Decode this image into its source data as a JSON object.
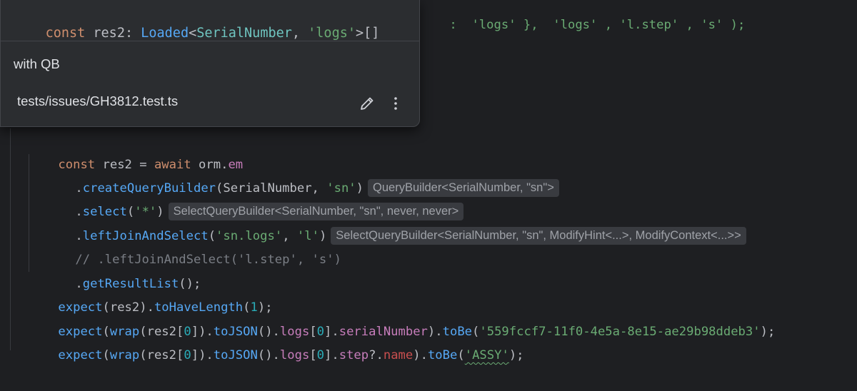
{
  "popup": {
    "signature": {
      "kw": "const",
      "name": "res2",
      "colon": ":",
      "type": "Loaded",
      "lt": "<",
      "cls": "SerialNumber",
      "comma": ", ",
      "str": "'logs'",
      "gt": ">[]"
    },
    "doc": "with QB",
    "file": "tests/issues/GH3812.test.ts",
    "edit_icon": "pencil-icon",
    "more_icon": "more-vertical-icon"
  },
  "code": {
    "top_fragment": ":  'logs' },  'logs' , 'l.step' , 's' );",
    "l1": {
      "a": "const",
      "b": " res2 = ",
      "c": "await",
      "d": " orm.",
      "e": "em"
    },
    "l2": {
      "a": ".",
      "b": "createQueryBuilder",
      "c": "(SerialNumber, ",
      "d": "'sn'",
      "e": ")",
      "hint": "QueryBuilder<SerialNumber, \"sn\">"
    },
    "l3": {
      "a": ".",
      "b": "select",
      "c": "(",
      "d": "'*'",
      "e": ")",
      "hint": "SelectQueryBuilder<SerialNumber, \"sn\", never, never>"
    },
    "l4": {
      "a": ".",
      "b": "leftJoinAndSelect",
      "c": "(",
      "d": "'sn.logs'",
      "e": ", ",
      "f": "'l'",
      "g": ")",
      "hint": "SelectQueryBuilder<SerialNumber, \"sn\", ModifyHint<...>, ModifyContext<...>>"
    },
    "l5": "// .leftJoinAndSelect('l.step', 's')",
    "l6": {
      "a": ".",
      "b": "getResultList",
      "c": "();"
    },
    "l7": {
      "a": "expect",
      "b": "(res2).",
      "c": "toHaveLength",
      "d": "(",
      "e": "1",
      "f": ");"
    },
    "l8": {
      "a": "expect",
      "b": "(",
      "c": "wrap",
      "d": "(res2[",
      "e": "0",
      "f": "]).",
      "g": "toJSON",
      "h": "().",
      "i": "logs",
      "j": "[",
      "k": "0",
      "l": "].",
      "m": "serialNumber",
      "n": ").",
      "o": "toBe",
      "p": "(",
      "q": "'559fccf7-11f0-4e5a-8e15-ae29b98ddeb3'",
      "r": ");"
    },
    "l9": {
      "a": "expect",
      "b": "(",
      "c": "wrap",
      "d": "(res2[",
      "e": "0",
      "f": "]).",
      "g": "toJSON",
      "h": "().",
      "i": "logs",
      "j": "[",
      "k": "0",
      "l": "].",
      "m": "step",
      "n": "?.",
      "o": "name",
      "p": ").",
      "q": "toBe",
      "r": "(",
      "s": "'ASSY'",
      "t": ");"
    }
  },
  "colors": {
    "background": "#1e1f22",
    "keyword": "#cf8e6d",
    "function": "#56a8f5",
    "string": "#6aab73",
    "number": "#2aacb8",
    "field": "#c77dbb",
    "comment": "#7a7e85",
    "popup_bg": "#2b2d30"
  }
}
